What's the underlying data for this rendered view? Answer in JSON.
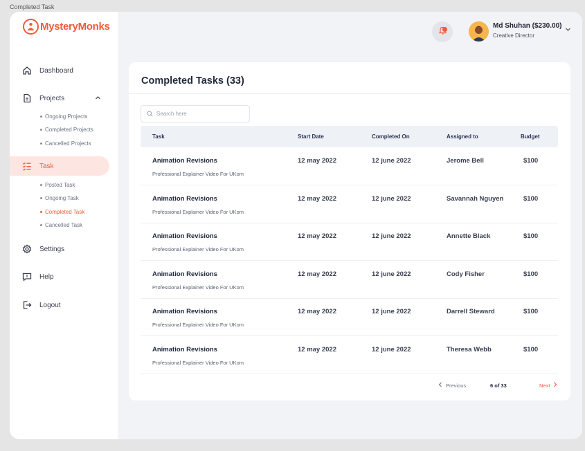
{
  "window": {
    "title": "Completed Task"
  },
  "brand": {
    "name": "MysteryMonks",
    "color": "#f15a3b",
    "logo_icon": "monk-icon"
  },
  "sidebar": {
    "items": [
      {
        "label": "Dashboard",
        "icon": "home-icon"
      },
      {
        "label": "Projects",
        "icon": "document-icon",
        "expanded": true
      },
      {
        "label": "Task",
        "icon": "checklist-icon",
        "active": true
      },
      {
        "label": "Settings",
        "icon": "gear-icon"
      },
      {
        "label": "Help",
        "icon": "chat-help-icon"
      },
      {
        "label": "Logout",
        "icon": "logout-icon"
      }
    ],
    "projects_sub": [
      "Ongoing Projects",
      "Completed Projects",
      "Cancelled Projects"
    ],
    "task_sub": [
      "Posted Task",
      "Ongoing Task",
      "Completed Task",
      "Cancelled Task"
    ],
    "active_sub": "Completed Task"
  },
  "header": {
    "notifications": {
      "icon": "bell-icon",
      "has_badge": true
    },
    "user": {
      "name": "Md Shuhan ($230.00)",
      "role": "Creative Director"
    }
  },
  "main": {
    "title": "Completed Tasks (33)",
    "search": {
      "placeholder": "Search here",
      "value": ""
    },
    "columns": [
      "Task",
      "Start Date",
      "Completed On",
      "Assigned to",
      "Budget"
    ],
    "rows": [
      {
        "task": "Animation Revisions",
        "subtitle": "Professional Explainer Video For UKom",
        "start": "12 may 2022",
        "completed": "12 june 2022",
        "assigned": "Jerome Bell",
        "budget": "$100"
      },
      {
        "task": "Animation Revisions",
        "subtitle": "Professional Explainer Video For UKom",
        "start": "12 may 2022",
        "completed": "12 june 2022",
        "assigned": "Savannah Nguyen",
        "budget": "$100"
      },
      {
        "task": "Animation Revisions",
        "subtitle": "Professional Explainer Video For UKom",
        "start": "12 may 2022",
        "completed": "12 june 2022",
        "assigned": "Annette Black",
        "budget": "$100"
      },
      {
        "task": "Animation Revisions",
        "subtitle": "Professional Explainer Video For UKom",
        "start": "12 may 2022",
        "completed": "12 june 2022",
        "assigned": "Cody Fisher",
        "budget": "$100"
      },
      {
        "task": "Animation Revisions",
        "subtitle": "Professional Explainer Video For UKom",
        "start": "12 may 2022",
        "completed": "12 june 2022",
        "assigned": "Darrell Steward",
        "budget": "$100"
      },
      {
        "task": "Animation Revisions",
        "subtitle": "Professional Explainer Video For UKom",
        "start": "12 may 2022",
        "completed": "12 june 2022",
        "assigned": "Theresa Webb",
        "budget": "$100"
      }
    ],
    "pagination": {
      "previous": "Previous",
      "info": "6 of 33",
      "next": "Next"
    }
  }
}
